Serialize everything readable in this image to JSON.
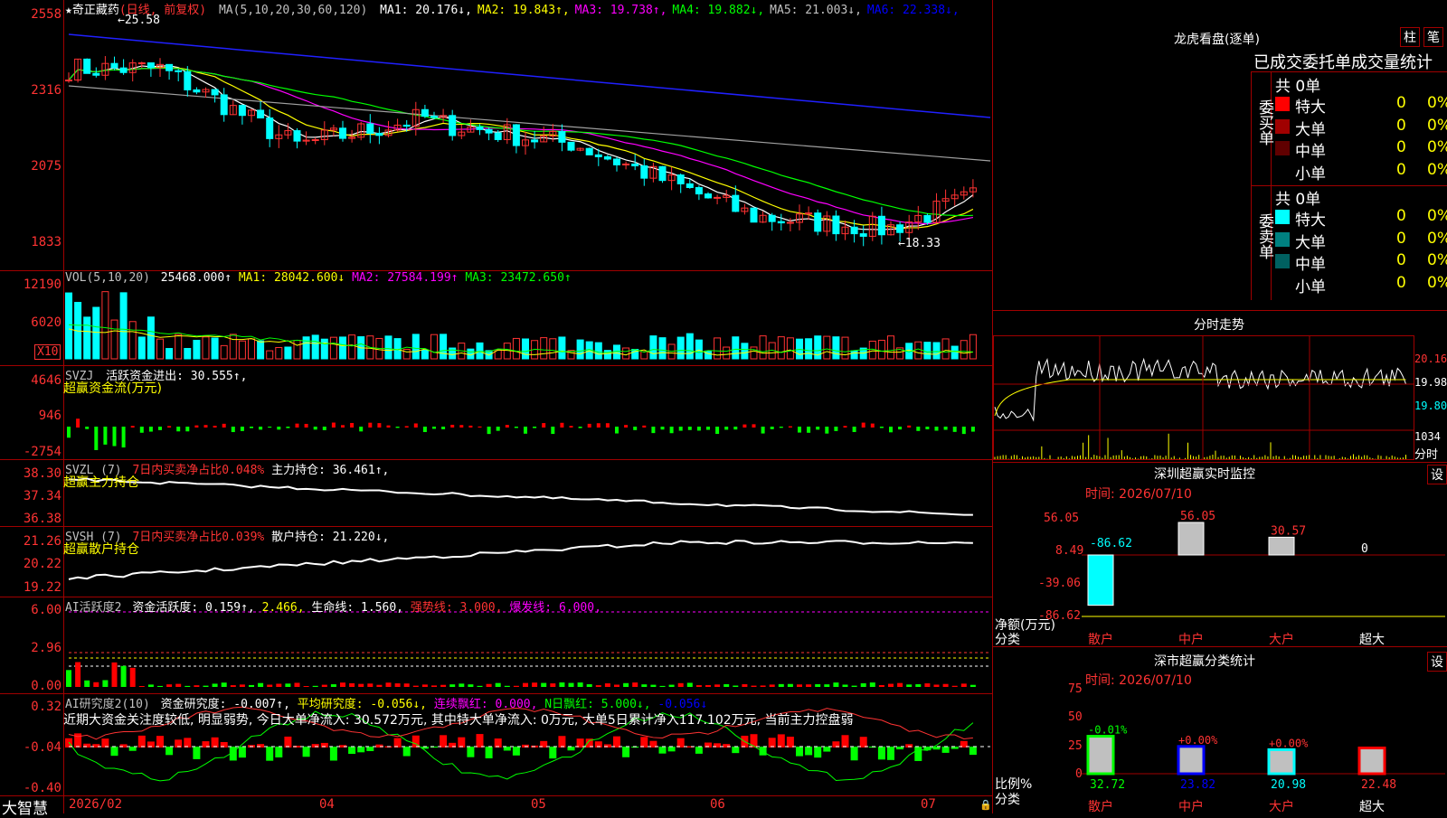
{
  "stock": {
    "title": "★奇正藏药",
    "period": "(日线, 前复权)",
    "ma_header": "MA(5,10,20,30,60,120)",
    "ma": [
      {
        "label": "MA1: 20.176",
        "arrow": "↓",
        "color": "#ffffff"
      },
      {
        "label": "MA2: 19.843",
        "arrow": "↑",
        "color": "#ffff00"
      },
      {
        "label": "MA3: 19.738",
        "arrow": "↑",
        "color": "#ff00ff"
      },
      {
        "label": "MA4: 19.882",
        "arrow": "↓",
        "color": "#00ff00"
      },
      {
        "label": "MA5: 21.003",
        "arrow": "↓",
        "color": "#c0c0c0"
      },
      {
        "label": "MA6: 22.338",
        "arrow": "↓",
        "color": "#0000ff"
      }
    ],
    "price_axis": [
      "2558",
      "2316",
      "2075",
      "1833"
    ],
    "high_mark": "25.58",
    "low_mark": "←18.33",
    "high_arrow": "←"
  },
  "vol": {
    "header": "VOL(5,10,20)",
    "value": "25468.000↑",
    "ma1": "MA1: 28042.600↓",
    "ma2": "MA2: 27584.199↑",
    "ma3": "MA3: 23472.650↑",
    "axis": [
      "12190",
      "6020"
    ],
    "unit": "X10"
  },
  "svzj": {
    "header": "SVZJ",
    "label": "活跃资金进出: 30.555↑,",
    "sub": "超赢资金流(万元)",
    "axis": [
      "4646",
      "946",
      "-2754"
    ]
  },
  "svzl": {
    "header": "SVZL (7)",
    "ratio": "7日内买卖净占比0.048%",
    "main": "主力持仓: 36.461↑,",
    "sub": "超赢主力持仓",
    "axis": [
      "38.30",
      "37.34",
      "36.38"
    ]
  },
  "svsh": {
    "header": "SVSH (7)",
    "ratio": "7日内买卖净占比0.039%",
    "main": "散户持仓: 21.220↓,",
    "sub": "超赢散户持仓",
    "axis": [
      "21.26",
      "20.22",
      "19.22"
    ]
  },
  "ai1": {
    "header": "AI活跃度2",
    "a": "资金活跃度: 0.159↑,",
    "b": "2.466,",
    "c": "生命线: 1.560,",
    "d": "强势线: 3.000,",
    "e": "爆发线: 6.000,",
    "axis": [
      "6.00",
      "2.96",
      "0.00"
    ]
  },
  "ai2": {
    "header": "AI研究度2(10)",
    "a": "资金研究度: -0.007↑,",
    "b": "平均研究度: -0.056↓,",
    "c": "连续飘红: 0.000,",
    "d": "N日飘红: 5.000↓,",
    "e": "-0.056↓",
    "summary": "近期大资金关注度较低, 明显弱势, 今日大单净流入: 30.572万元, 其中特大单净流入: 0万元, 大单5日累计净入117.102万元, 当前主力控盘弱",
    "axis": [
      "0.32",
      "-0.04",
      "-0.40"
    ]
  },
  "xaxis": {
    "brand": "大智慧",
    "labels": [
      "2026/02",
      "04",
      "05",
      "06",
      "07"
    ]
  },
  "lhb": {
    "title": "龙虎看盘(逐单)",
    "btn1": "柱",
    "btn2": "笔",
    "subtitle": "已成交委托单成交量统计",
    "buy_side": "委买单",
    "sell_side": "委卖单",
    "buy_total": "共 0单",
    "sell_total": "共 0单",
    "buy_rows": [
      {
        "name": "特大",
        "count": "0",
        "pct": "0%",
        "color": "#ff0000"
      },
      {
        "name": "大单",
        "count": "0",
        "pct": "0%",
        "color": "#a00000"
      },
      {
        "name": "中单",
        "count": "0",
        "pct": "0%",
        "color": "#600000"
      },
      {
        "name": "小单",
        "count": "0",
        "pct": "0%",
        "color": "#000000"
      }
    ],
    "sell_rows": [
      {
        "name": "特大",
        "count": "0",
        "pct": "0%",
        "color": "#00ffff"
      },
      {
        "name": "大单",
        "count": "0",
        "pct": "0%",
        "color": "#008080"
      },
      {
        "name": "中单",
        "count": "0",
        "pct": "0%",
        "color": "#006060"
      },
      {
        "name": "小单",
        "count": "0",
        "pct": "0%",
        "color": "#000000"
      }
    ]
  },
  "intraday": {
    "title": "分时走势",
    "axis": [
      "20.16",
      "19.98",
      "19.80"
    ],
    "vol_axis": [
      "1034",
      "分时"
    ]
  },
  "monitor": {
    "title": "深圳超赢实时监控",
    "btn": "设",
    "time": "时间: 2026/07/10",
    "axis": [
      "56.05",
      "8.49",
      "-39.06",
      "-86.62"
    ],
    "ylabel": "净额(万元)",
    "xlabel": "分类",
    "categories": [
      "散户",
      "中户",
      "大户",
      "超大"
    ],
    "values": [
      -86.62,
      56.05,
      30.57,
      0
    ],
    "value_labels": [
      "-86.62",
      "56.05",
      "30.57",
      "0"
    ]
  },
  "classify": {
    "title": "深市超赢分类统计",
    "btn": "设",
    "time": "时间: 2026/07/10",
    "axis": [
      "75",
      "50",
      "25",
      "0"
    ],
    "ylabel": "比例%",
    "xlabel": "分类",
    "categories": [
      "散户",
      "中户",
      "大户",
      "超大"
    ],
    "values": [
      32.72,
      23.82,
      20.98,
      22.48
    ],
    "change_labels": [
      "-0.01%",
      "+0.00%",
      "+0.00%",
      ""
    ],
    "colors": [
      "#00ff00",
      "#0000ff",
      "#00ffff",
      "#ff0000"
    ]
  },
  "chart_data": {
    "type": "bar",
    "title": "深圳超赢实时监控",
    "categories": [
      "散户",
      "中户",
      "大户",
      "超大"
    ],
    "series": [
      {
        "name": "净额(万元)",
        "values": [
          -86.62,
          56.05,
          30.57,
          0
        ]
      },
      {
        "name": "比例%",
        "values": [
          32.72,
          23.82,
          20.98,
          22.48
        ]
      }
    ],
    "ylim": [
      -86.62,
      56.05
    ]
  }
}
